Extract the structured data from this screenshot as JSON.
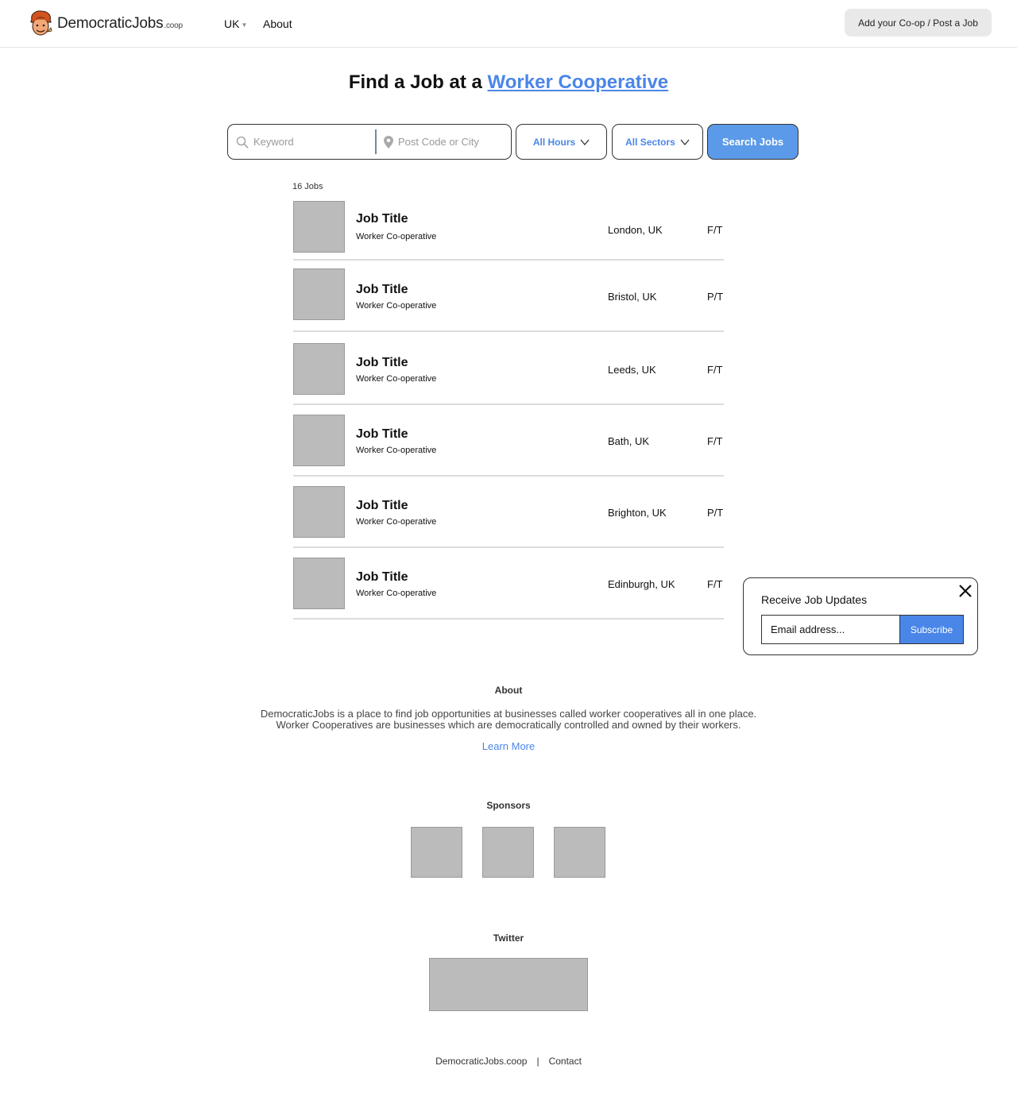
{
  "header": {
    "logo_text": "DemocraticJobs",
    "logo_tld": ".coop",
    "region_label": "UK",
    "about_label": "About",
    "post_button": "Add your Co-op / Post a Job"
  },
  "hero": {
    "title_prefix": "Find a Job at a ",
    "title_link": "Worker Cooperative",
    "link_color": "#4a86e8"
  },
  "search": {
    "keyword_placeholder": "Keyword",
    "location_placeholder": "Post Code or City",
    "hours_label": "All Hours",
    "sectors_label": "All Sectors",
    "button_label": "Search Jobs",
    "button_color": "#5b9ae8"
  },
  "jobs": {
    "count_label": "16 Jobs",
    "items": [
      {
        "title": "Job Title",
        "org": "Worker Co-operative",
        "location": "London, UK",
        "hours": "F/T"
      },
      {
        "title": "Job Title",
        "org": "Worker Co-operative",
        "location": "Bristol, UK",
        "hours": "P/T"
      },
      {
        "title": "Job Title",
        "org": "Worker Co-operative",
        "location": "Leeds, UK",
        "hours": "F/T"
      },
      {
        "title": "Job Title",
        "org": "Worker Co-operative",
        "location": "Bath, UK",
        "hours": "F/T"
      },
      {
        "title": "Job Title",
        "org": "Worker Co-operative",
        "location": "Brighton, UK",
        "hours": "P/T"
      },
      {
        "title": "Job Title",
        "org": "Worker Co-operative",
        "location": "Edinburgh, UK",
        "hours": "F/T"
      }
    ]
  },
  "popup": {
    "title": "Receive Job Updates",
    "email_value": "Email address...",
    "subscribe_label": "Subscribe"
  },
  "about": {
    "heading": "About",
    "line1": "DemocraticJobs is a place to find job opportunities at businesses called worker cooperatives all in one place.",
    "line2": "Worker Cooperatives are businesses which are democratically controlled and owned by their workers.",
    "learn_more": "Learn More"
  },
  "sponsors": {
    "heading": "Sponsors"
  },
  "twitter": {
    "heading": "Twitter"
  },
  "footer": {
    "site_link": "DemocraticJobs.coop",
    "separator": "|",
    "contact_link": "Contact"
  }
}
